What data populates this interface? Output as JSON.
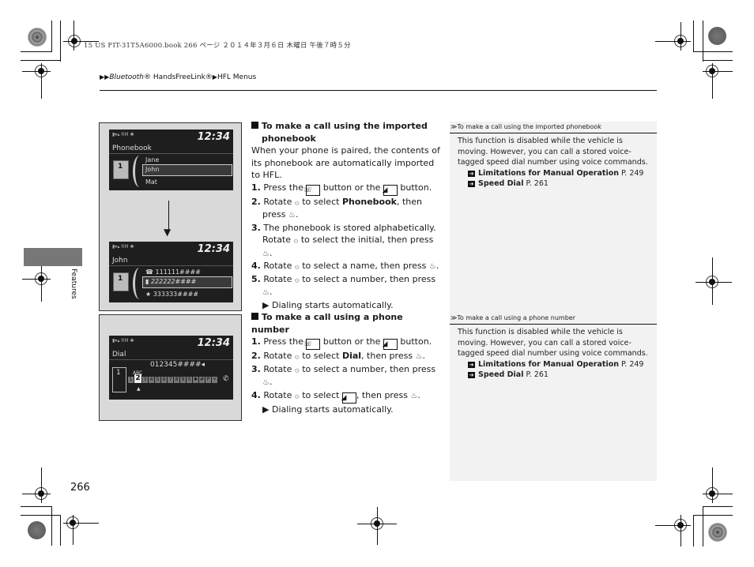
{
  "print_header": "15 US FIT-31T5A6000.book  266 ページ  ２０１４年３月６日  木曜日  午後７時５分",
  "breadcrumb": {
    "items": [
      "Bluetooth® HandsFreeLink®",
      "HFL Menus"
    ],
    "italic_part": "Bluetooth",
    "part1_rest": "® HandsFreeLink®",
    "part2": "HFL Menus"
  },
  "side_tab": {
    "label": "Features"
  },
  "page_number": "266",
  "figures": {
    "phonebook_screen": {
      "time": "12:34",
      "title": "Phonebook",
      "status": "RM",
      "book_number": "1",
      "items": [
        "Jane",
        "John",
        "Mat"
      ],
      "selected": "John"
    },
    "contact_screen": {
      "time": "12:34",
      "title": "John",
      "status": "RM",
      "book_number": "1",
      "items": [
        "111111####",
        "222222####",
        "333333####"
      ],
      "selected": "222222####"
    },
    "dial_screen": {
      "time": "12:34",
      "title": "Dial",
      "status": "RM",
      "number": "012345####◂",
      "phone_number_icon": "1",
      "letters": "ABC",
      "keys": [
        "1",
        "2",
        "3",
        "4",
        "5",
        "6",
        "7",
        "8",
        "9",
        "0",
        "✱",
        "#",
        "P",
        "+"
      ],
      "selected_key": "2"
    }
  },
  "section1": {
    "heading_line1": "To make a call using the imported",
    "heading_line2": "phonebook",
    "intro": "When your phone is paired, the contents of its phonebook are automatically imported to HFL.",
    "steps": [
      {
        "n": "1.",
        "a": "Press the ",
        "b": " button or the ",
        "c": " button."
      },
      {
        "n": "2.",
        "a": "Rotate ",
        "b": " to select ",
        "bold": "Phonebook",
        "c": ", then press ",
        "d": "."
      },
      {
        "n": "3.",
        "a": "The phonebook is stored alphabetically. Rotate ",
        "b": " to select the initial, then press ",
        "c": "."
      },
      {
        "n": "4.",
        "a": "Rotate ",
        "b": " to select a name, then press ",
        "c": "."
      },
      {
        "n": "5.",
        "a": "Rotate ",
        "b": " to select a number, then press ",
        "c": "."
      }
    ],
    "note": "Dialing starts automatically."
  },
  "section2": {
    "heading": "To make a call using a phone number",
    "steps": [
      {
        "n": "1.",
        "a": "Press the ",
        "b": " button or the ",
        "c": " button."
      },
      {
        "n": "2.",
        "a": "Rotate ",
        "b": " to select ",
        "bold": "Dial",
        "c": ", then press ",
        "d": "."
      },
      {
        "n": "3.",
        "a": "Rotate ",
        "b": " to select a number, then press ",
        "c": "."
      },
      {
        "n": "4.",
        "a": "Rotate ",
        "b": " to select ",
        "c": ", then press ",
        "d": "."
      }
    ],
    "note": "Dialing starts automatically."
  },
  "sidebar1": {
    "heading": "To make a call using the imported phonebook",
    "body": "This function is disabled while the vehicle is moving. However, you can call a stored voice-tagged speed dial number using voice commands.",
    "refs": [
      {
        "title": "Limitations for Manual Operation",
        "page": "P. 249"
      },
      {
        "title": "Speed Dial",
        "page": "P. 261"
      }
    ]
  },
  "sidebar2": {
    "heading": "To make a call using a phone number",
    "body": "This function is disabled while the vehicle is moving. However, you can call a stored voice-tagged speed dial number using voice commands.",
    "refs": [
      {
        "title": "Limitations for Manual Operation",
        "page": "P. 249"
      },
      {
        "title": "Speed Dial",
        "page": "P. 261"
      }
    ]
  },
  "icons": {
    "phone_button": "phone-icon",
    "pickup_button": "pickup-icon",
    "selector_knob": "selector-knob-icon",
    "press_knob": "press-knob-icon",
    "note_arrow": "▶",
    "section_marker": "■",
    "ref_arrow": "➔",
    "side_marker": "≫"
  }
}
